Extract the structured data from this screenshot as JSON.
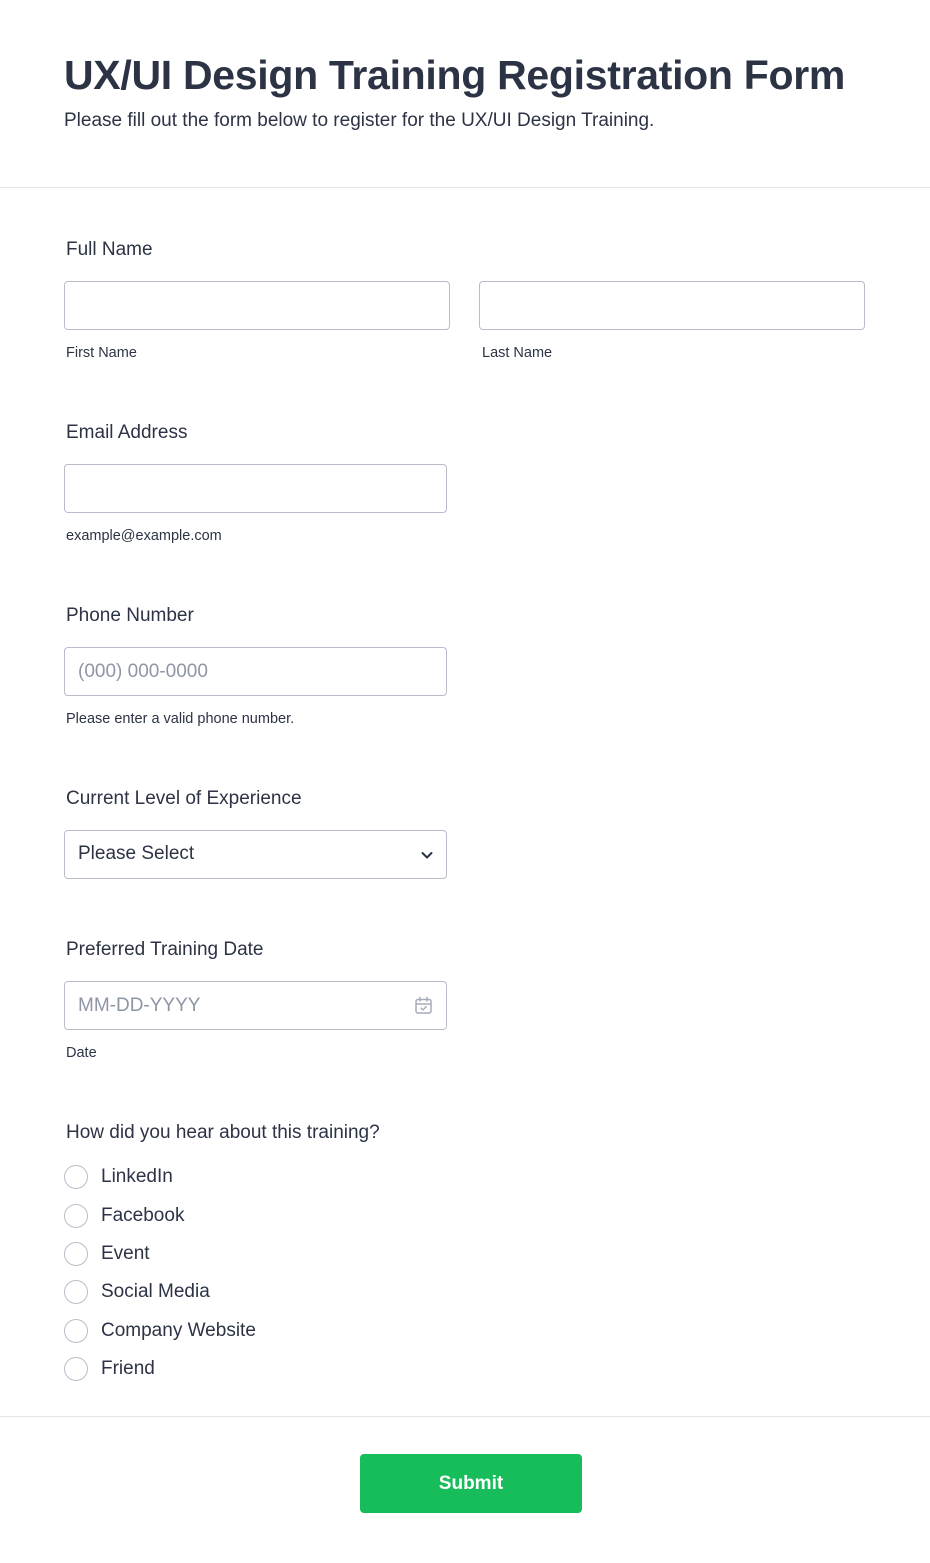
{
  "header": {
    "title": "UX/UI Design Training Registration Form",
    "subtitle": "Please fill out the form below to register for the UX/UI Design Training."
  },
  "full_name": {
    "label": "Full Name",
    "first": {
      "value": "",
      "sublabel": "First Name"
    },
    "last": {
      "value": "",
      "sublabel": "Last Name"
    }
  },
  "email": {
    "label": "Email Address",
    "value": "",
    "sublabel": "example@example.com"
  },
  "phone": {
    "label": "Phone Number",
    "placeholder": "(000) 000-0000",
    "sublabel": "Please enter a valid phone number."
  },
  "experience": {
    "label": "Current Level of Experience",
    "selected": "Please Select",
    "icon": "chevron-down-icon"
  },
  "training_date": {
    "label": "Preferred Training Date",
    "placeholder": "MM-DD-YYYY",
    "sublabel": "Date",
    "icon": "calendar-icon"
  },
  "referral": {
    "label": "How did you hear about this training?",
    "options": [
      "LinkedIn",
      "Facebook",
      "Event",
      "Social Media",
      "Company Website",
      "Friend"
    ]
  },
  "submit": {
    "label": "Submit",
    "color": "#18bd5b"
  },
  "colors": {
    "text": "#2c3345",
    "border": "#b8bdc9",
    "placeholder": "#8e95a5",
    "divider": "#e3e5ec"
  }
}
